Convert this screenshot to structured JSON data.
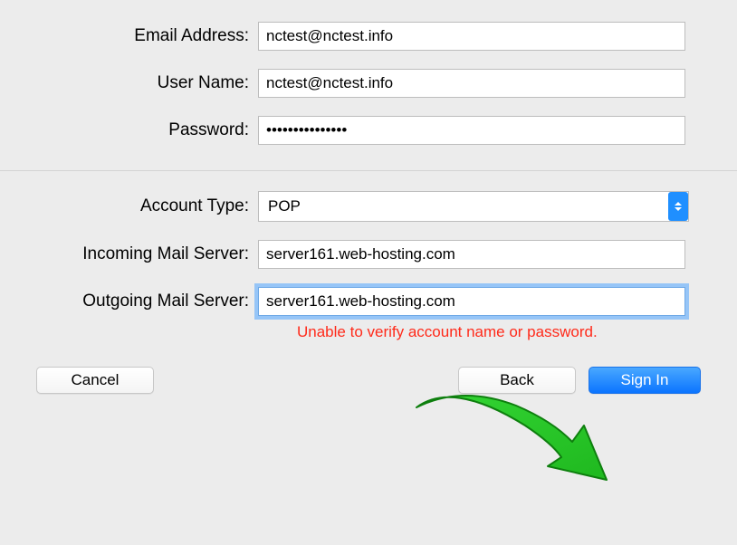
{
  "form": {
    "email_label": "Email Address:",
    "email_value": "nctest@nctest.info",
    "username_label": "User Name:",
    "username_value": "nctest@nctest.info",
    "password_label": "Password:",
    "password_value": "•••••••••••••••",
    "account_type_label": "Account Type:",
    "account_type_value": "POP",
    "incoming_label": "Incoming Mail Server:",
    "incoming_value": "server161.web-hosting.com",
    "outgoing_label": "Outgoing Mail Server:",
    "outgoing_value": "server161.web-hosting.com"
  },
  "error_message": "Unable to verify account name or password.",
  "buttons": {
    "cancel": "Cancel",
    "back": "Back",
    "sign_in": "Sign In"
  },
  "colors": {
    "accent": "#1f8fff",
    "error": "#ff2a1a",
    "arrow": "#29c229"
  }
}
